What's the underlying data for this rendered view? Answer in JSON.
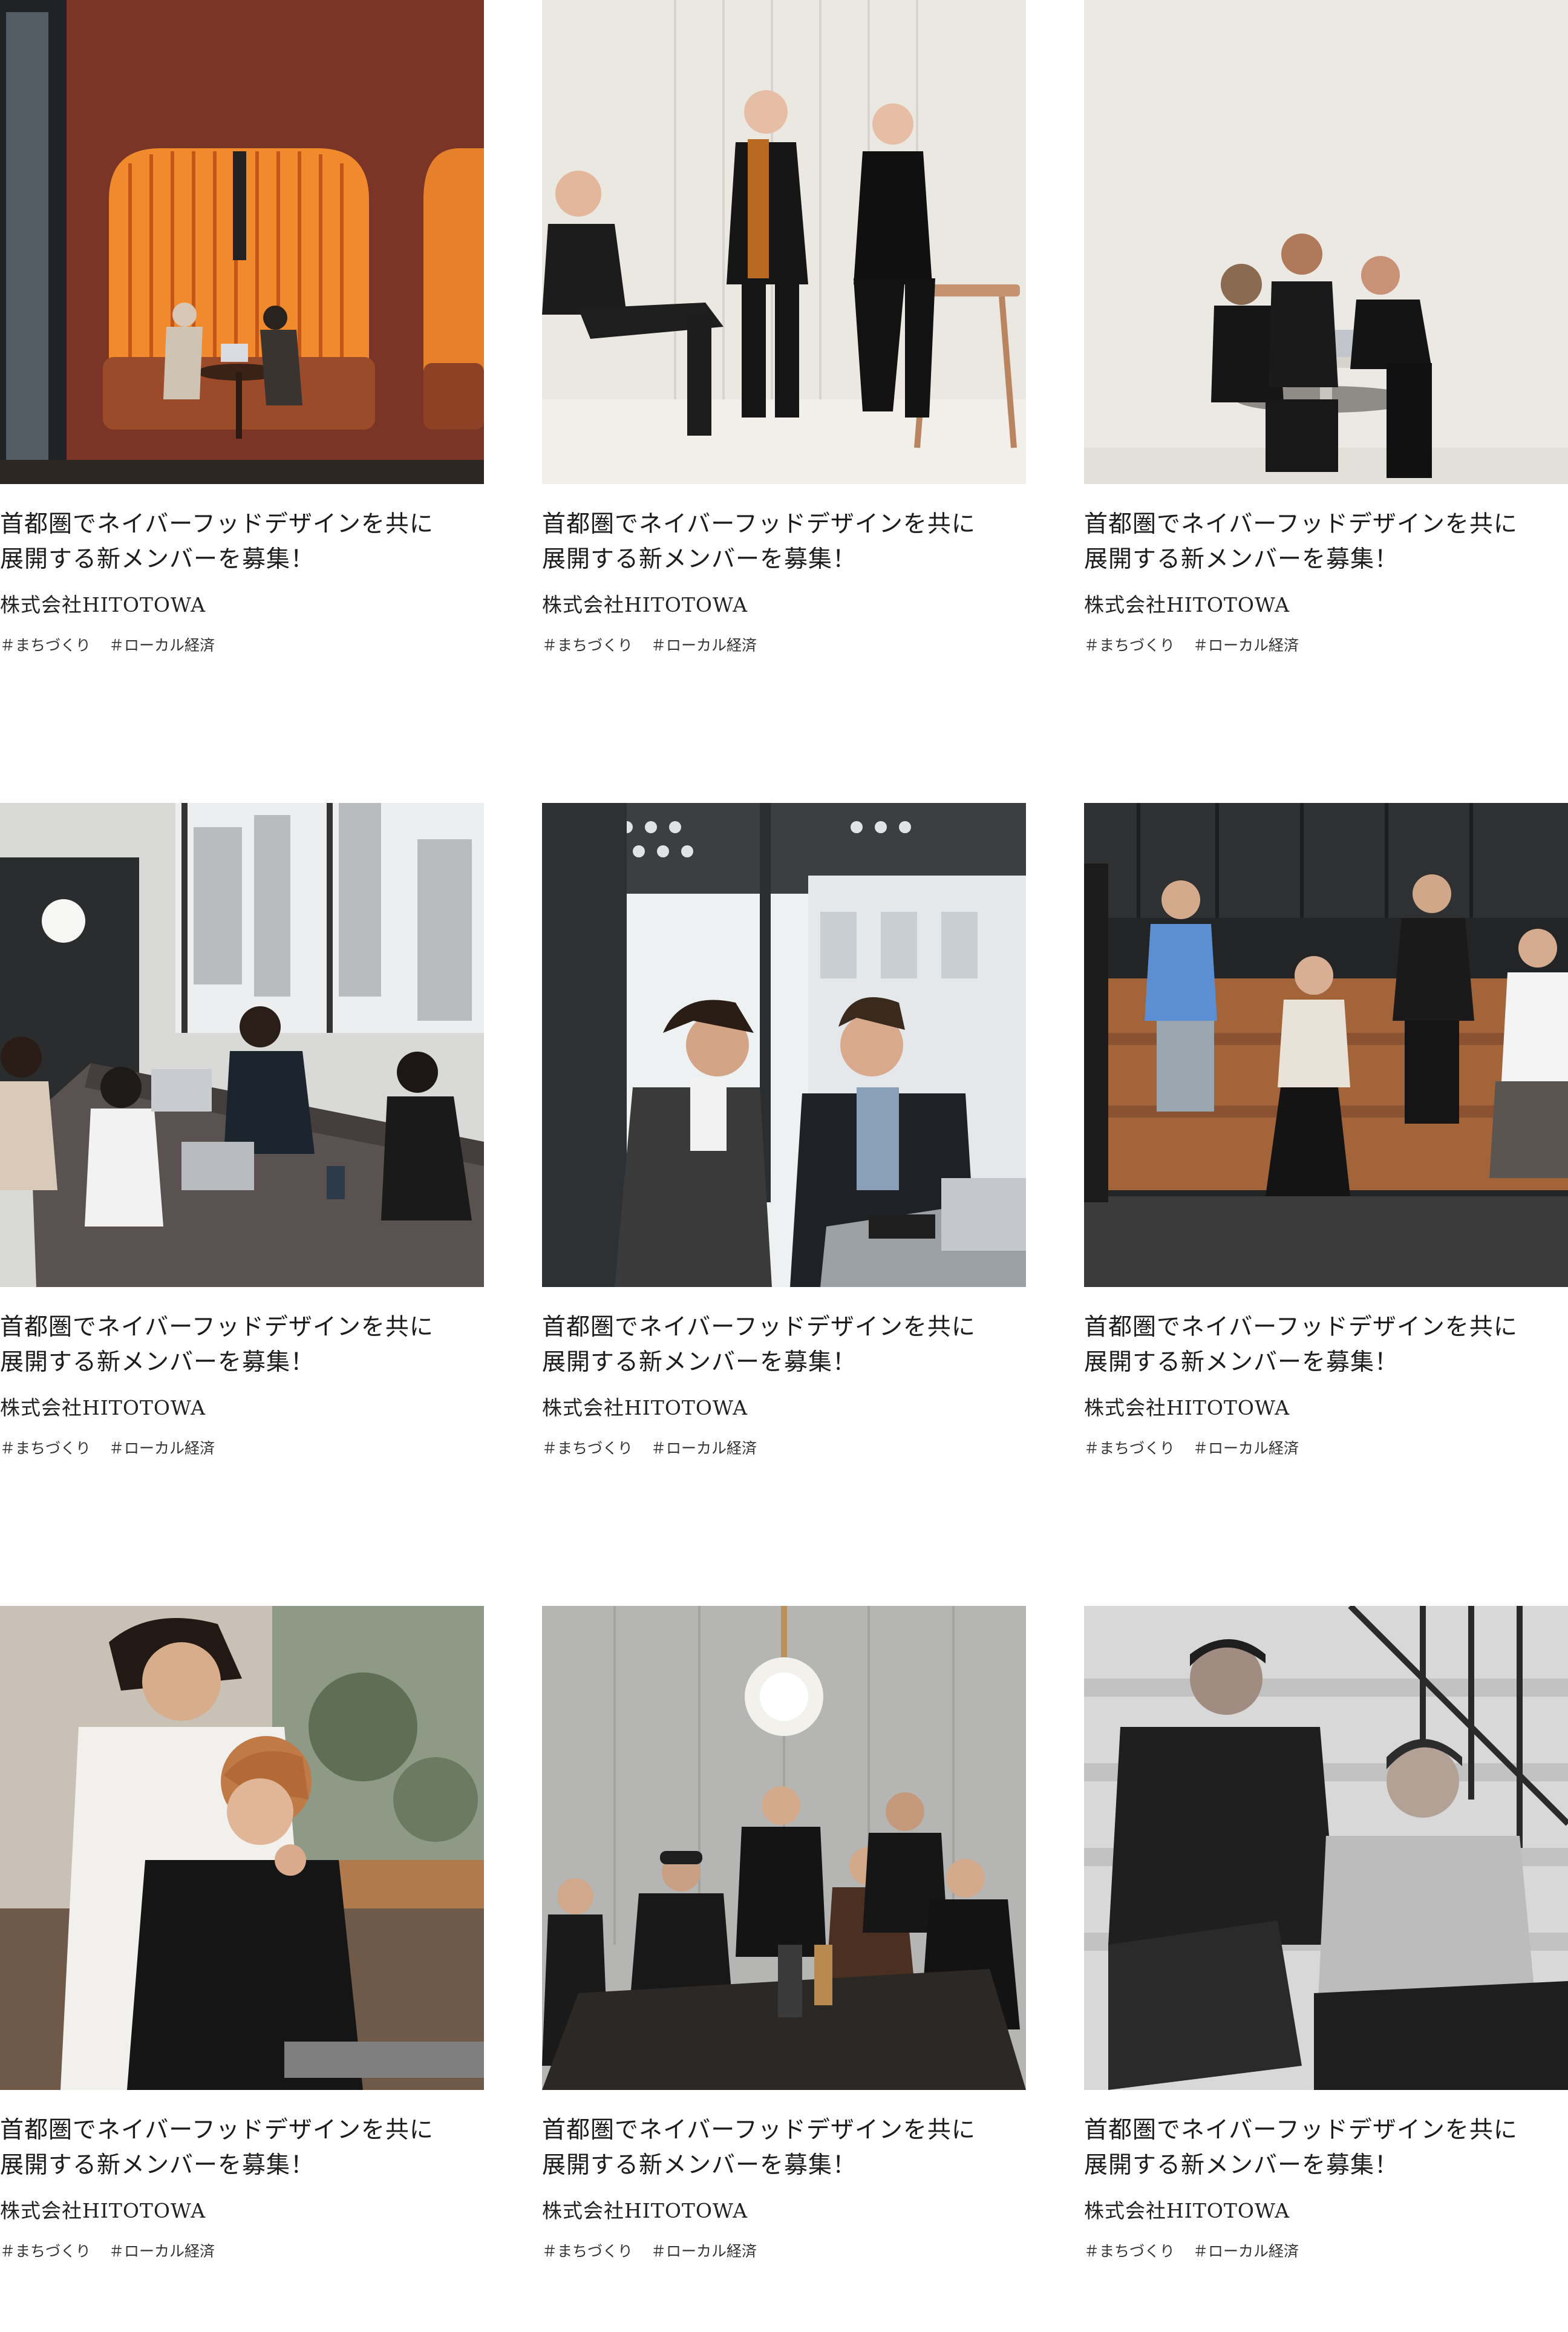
{
  "cards": [
    {
      "image": "photo-orange-booth-meeting",
      "title": "首都圏でネイバーフッドデザインを共に\n展開する新メンバーを募集！",
      "company": "株式会社HITOTOWA",
      "tags": [
        "＃まちづくり",
        "＃ローカル経済"
      ]
    },
    {
      "image": "photo-three-men-white-room",
      "title": "首都圏でネイバーフッドデザインを共に\n展開する新メンバーを募集！",
      "company": "株式会社HITOTOWA",
      "tags": [
        "＃まちづくり",
        "＃ローカル経済"
      ]
    },
    {
      "image": "photo-team-at-standing-table",
      "title": "首都圏でネイバーフッドデザインを共に\n展開する新メンバーを募集！",
      "company": "株式会社HITOTOWA",
      "tags": [
        "＃まちづくり",
        "＃ローカル経済"
      ]
    },
    {
      "image": "photo-office-meeting-laptops",
      "title": "首都圏でネイバーフッドデザインを共に\n展開する新メンバーを募集！",
      "company": "株式会社HITOTOWA",
      "tags": [
        "＃まちづくり",
        "＃ローカル経済"
      ]
    },
    {
      "image": "photo-two-men-reviewing-notes",
      "title": "首都圏でネイバーフッドデザインを共に\n展開する新メンバーを募集！",
      "company": "株式会社HITOTOWA",
      "tags": [
        "＃まちづくり",
        "＃ローカル経済"
      ]
    },
    {
      "image": "photo-group-on-wooden-steps",
      "title": "首都圏でネイバーフッドデザインを共に\n展開する新メンバーを募集！",
      "company": "株式会社HITOTOWA",
      "tags": [
        "＃まちづくり",
        "＃ローカル経済"
      ]
    },
    {
      "image": "photo-mentor-with-colleague",
      "title": "首都圏でネイバーフッドデザインを共に\n展開する新メンバーを募集！",
      "company": "株式会社HITOTOWA",
      "tags": [
        "＃まちづくり",
        "＃ローカル経済"
      ]
    },
    {
      "image": "photo-team-around-table",
      "title": "首都圏でネイバーフッドデザインを共に\n展開する新メンバーを募集！",
      "company": "株式会社HITOTOWA",
      "tags": [
        "＃まちづくり",
        "＃ローカル経済"
      ]
    },
    {
      "image": "photo-two-men-on-stairs-bw",
      "title": "首都圏でネイバーフッドデザインを共に\n展開する新メンバーを募集！",
      "company": "株式会社HITOTOWA",
      "tags": [
        "＃まちづくり",
        "＃ローカル経済"
      ]
    }
  ]
}
